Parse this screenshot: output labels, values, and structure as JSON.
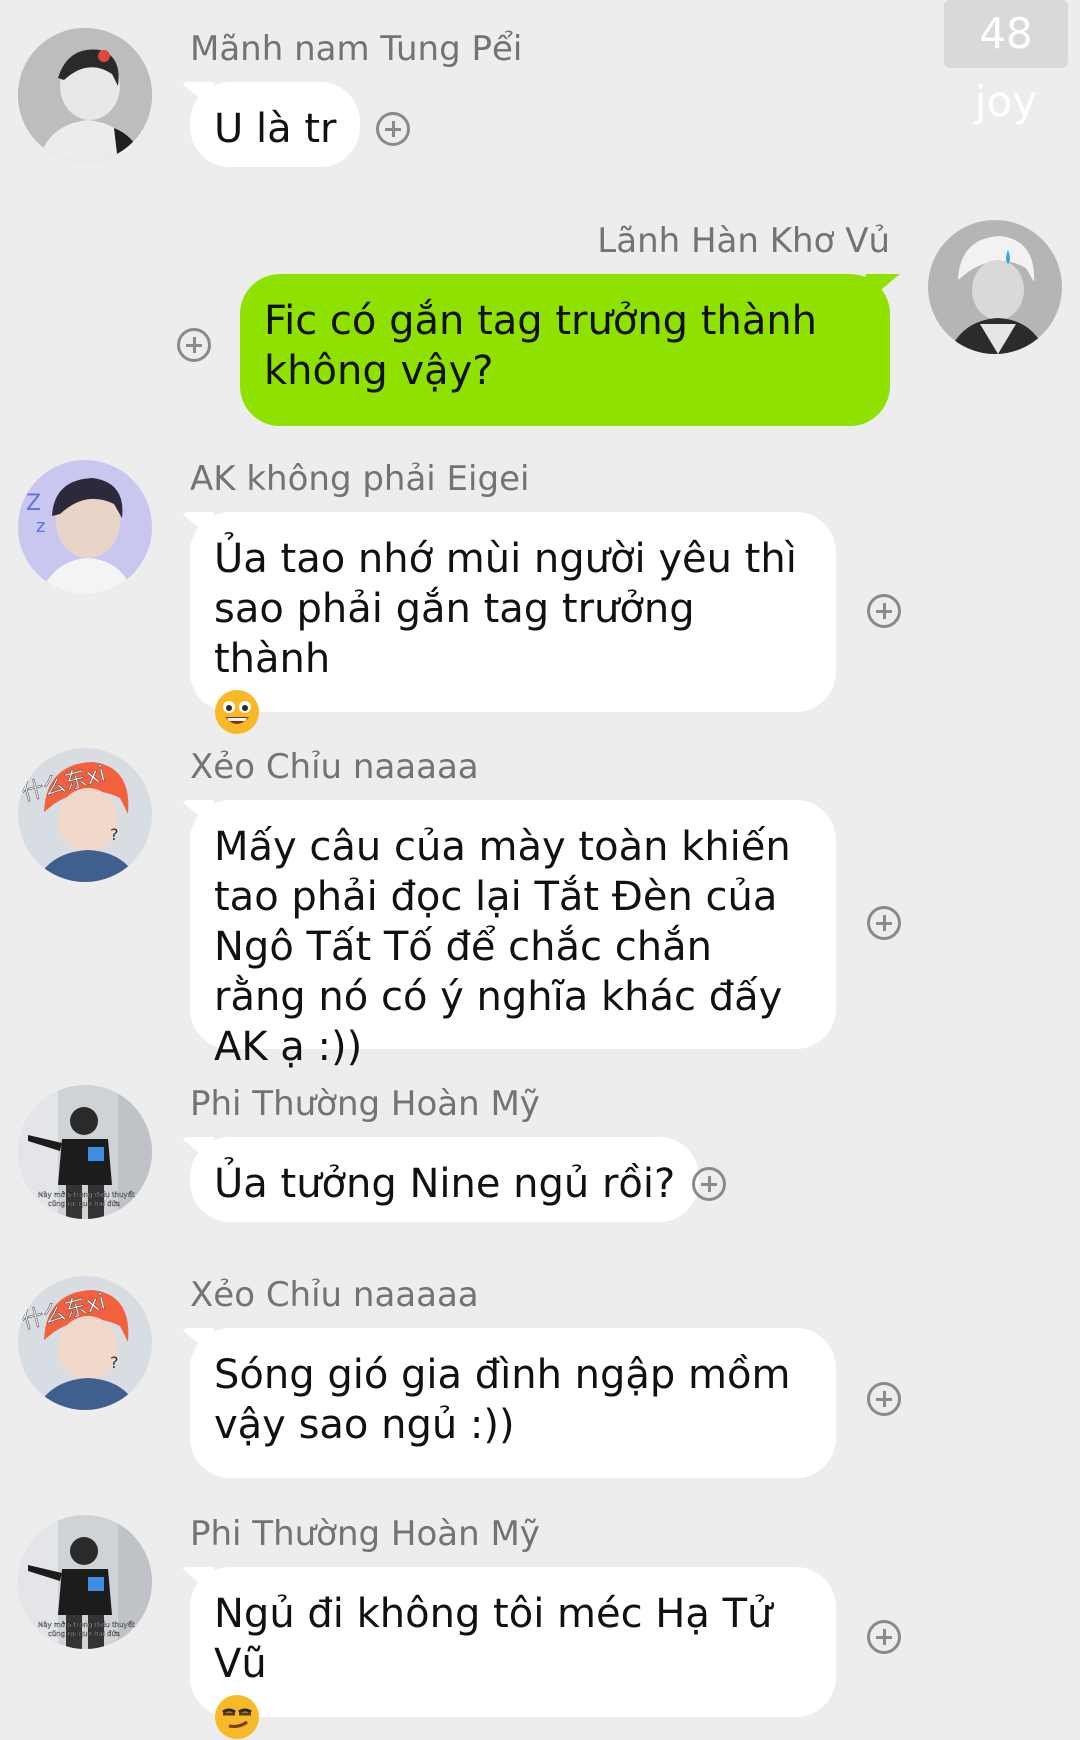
{
  "watermark": "48 joy",
  "messages": [
    {
      "sender": "Mãnh nam Tung Pểi",
      "text": "U là tr",
      "side": "left",
      "avatar": "avatar-bw-boy"
    },
    {
      "sender": "Lãnh Hàn Khơ Vủ",
      "text": "Fic có gắn tag trưởng thành không vậy?",
      "side": "right",
      "avatar": "avatar-bw-blond"
    },
    {
      "sender": "AK không phải Eigei",
      "text": "Ủa tao nhớ mùi người yêu thì sao phải gắn tag trưởng thành",
      "emoji": "grinning-face-emoji",
      "side": "left",
      "avatar": "avatar-sleepy"
    },
    {
      "sender": "Xẻo Chỉu naaaaa",
      "text": "Mấy câu của mày toàn khiến tao phải đọc lại Tắt Đèn của Ngô Tất Tố để chắc chắn rằng nó có ý nghĩa khác đấy AK ạ :))",
      "side": "left",
      "avatar": "avatar-red-hair"
    },
    {
      "sender": "Phi Thường Hoàn Mỹ",
      "text": "Ủa tưởng Nine ngủ rồi?",
      "side": "left",
      "avatar": "avatar-dance"
    },
    {
      "sender": "Xẻo Chỉu naaaaa",
      "text": "Sóng gió gia đình ngập mồm vậy sao ngủ :))",
      "side": "left",
      "avatar": "avatar-red-hair"
    },
    {
      "sender": "Phi Thường Hoàn Mỹ",
      "text": "Ngủ đi không tôi méc Hạ Tử Vũ",
      "emoji": "smirk-face-emoji",
      "side": "left",
      "avatar": "avatar-dance"
    }
  ],
  "avatar_overlay_text": {
    "red_hair": "什么东xi",
    "red_hair_mark": "?",
    "dance_subtitle_1": "Này mở ở trong điều thuyết",
    "dance_subtitle_2": "cũng rồi quá hai đứa"
  },
  "colors": {
    "background": "#ededed",
    "bubble_left": "#ffffff",
    "bubble_right": "#8fe200",
    "sender_text": "#737373"
  }
}
